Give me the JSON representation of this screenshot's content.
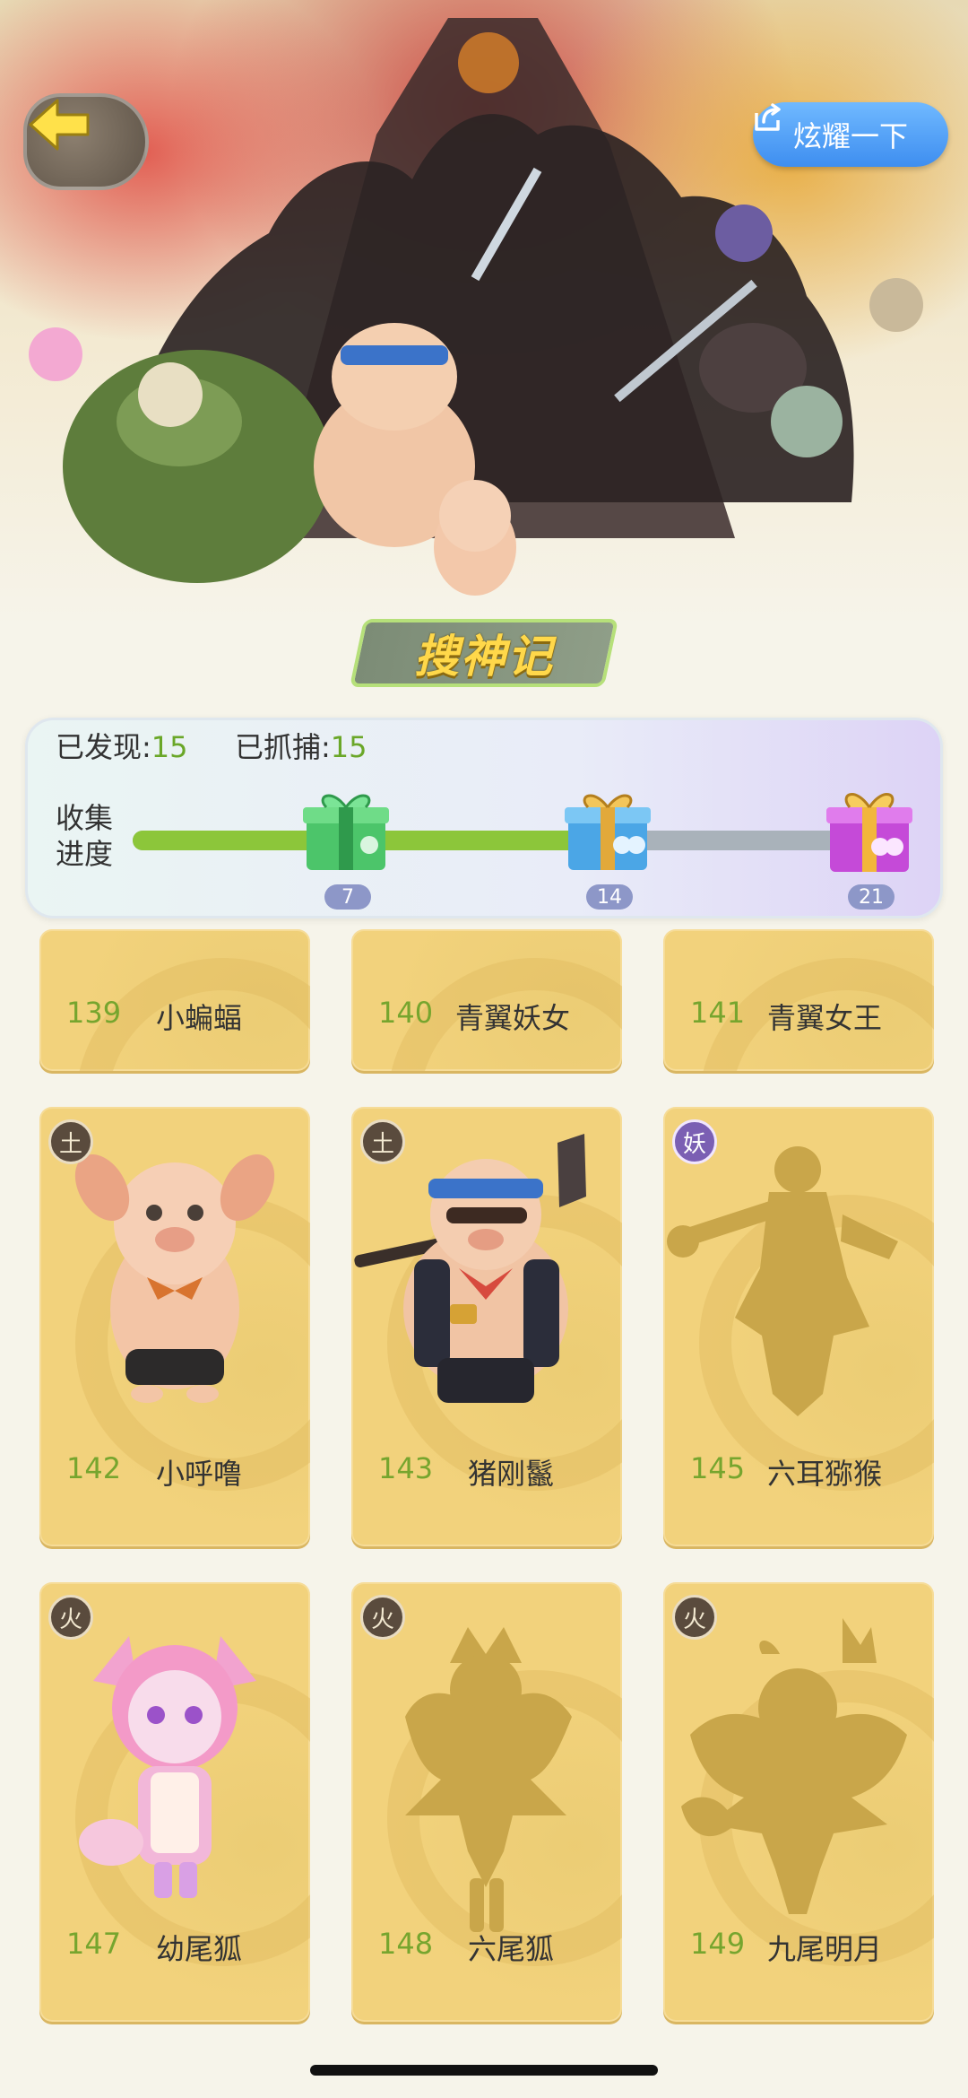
{
  "header": {
    "share_label": "炫耀一下",
    "title": "搜神记"
  },
  "stats": {
    "discovered_label": "已发现:",
    "discovered_value": "15",
    "captured_label": "已抓捕:",
    "captured_value": "15"
  },
  "progress": {
    "label": "收集进度",
    "milestones": [
      "7",
      "14",
      "21"
    ],
    "fill_fraction": 0.61
  },
  "cards": [
    {
      "num": "139",
      "name": "小蝙蝠",
      "element": "",
      "revealed": false
    },
    {
      "num": "140",
      "name": "青翼妖女",
      "element": "",
      "revealed": false
    },
    {
      "num": "141",
      "name": "青翼女王",
      "element": "",
      "revealed": false
    },
    {
      "num": "142",
      "name": "小呼噜",
      "element": "土",
      "revealed": true
    },
    {
      "num": "143",
      "name": "猪刚鬣",
      "element": "土",
      "revealed": true
    },
    {
      "num": "145",
      "name": "六耳猕猴",
      "element": "妖",
      "revealed": false
    },
    {
      "num": "147",
      "name": "幼尾狐",
      "element": "火",
      "revealed": true
    },
    {
      "num": "148",
      "name": "六尾狐",
      "element": "火",
      "revealed": false
    },
    {
      "num": "149",
      "name": "九尾明月",
      "element": "火",
      "revealed": false
    }
  ],
  "colors": {
    "accent_green": "#8cc63a",
    "share_blue": "#3e8ef0",
    "card_gold": "#f2d27c"
  }
}
